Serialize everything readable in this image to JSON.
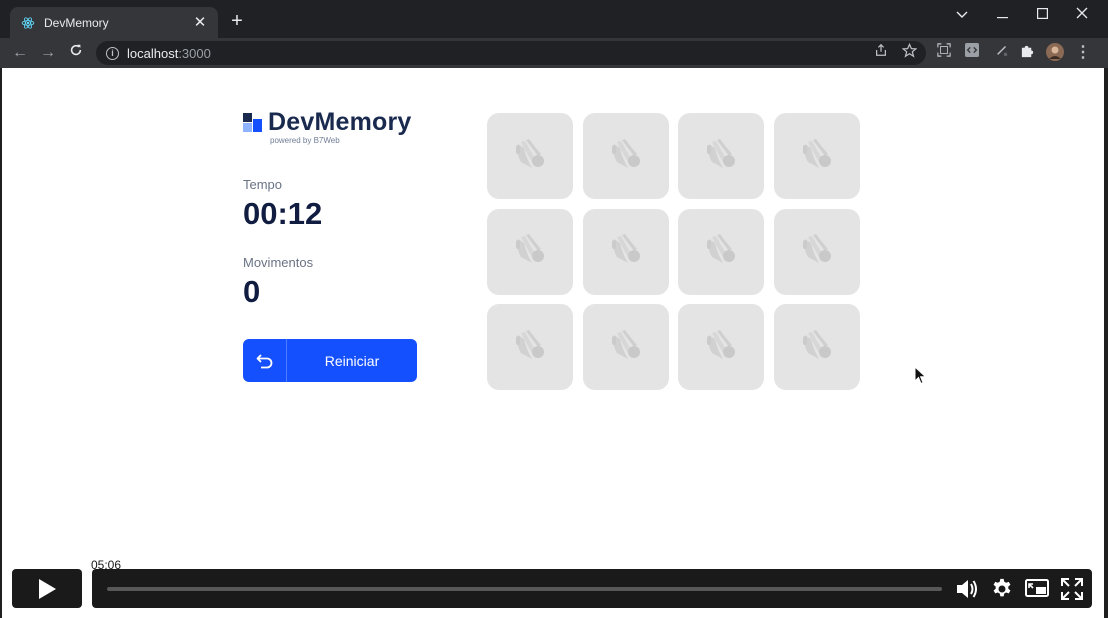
{
  "browser": {
    "tab_title": "DevMemory",
    "url_host": "localhost",
    "url_port": ":3000"
  },
  "app": {
    "logo_name": "DevMemory",
    "logo_sub": "powered by B7Web",
    "logo_colors": [
      "#1550ff",
      "#1a2a4f",
      "#8fb3ff"
    ],
    "time_label": "Tempo",
    "time_value": "00:12",
    "moves_label": "Movimentos",
    "moves_value": "0",
    "reset_label": "Reiniciar",
    "accent": "#1550ff",
    "cards": [
      {
        "state": "hidden",
        "icon": "b7web-icon"
      },
      {
        "state": "hidden",
        "icon": "b7web-icon"
      },
      {
        "state": "hidden",
        "icon": "b7web-icon"
      },
      {
        "state": "hidden",
        "icon": "b7web-icon"
      },
      {
        "state": "hidden",
        "icon": "b7web-icon"
      },
      {
        "state": "hidden",
        "icon": "b7web-icon"
      },
      {
        "state": "hidden",
        "icon": "b7web-icon"
      },
      {
        "state": "hidden",
        "icon": "b7web-icon"
      },
      {
        "state": "hidden",
        "icon": "b7web-icon"
      },
      {
        "state": "hidden",
        "icon": "b7web-icon"
      },
      {
        "state": "hidden",
        "icon": "b7web-icon"
      },
      {
        "state": "hidden",
        "icon": "b7web-icon"
      }
    ]
  },
  "player": {
    "time_tooltip": "05:06",
    "progress": 0
  }
}
